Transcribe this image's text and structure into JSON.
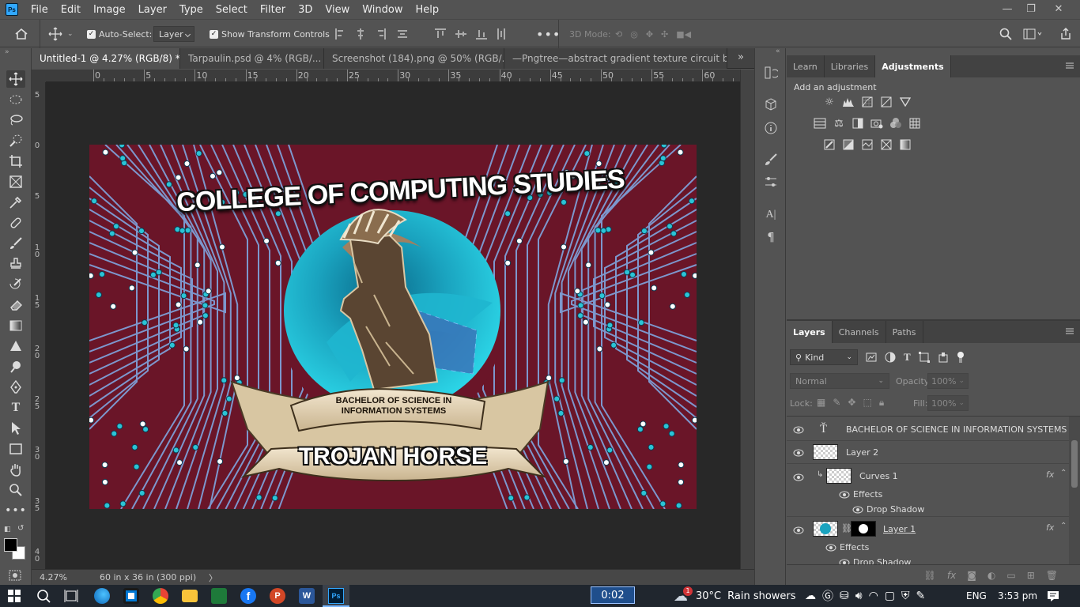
{
  "app": {
    "logo": "Ps"
  },
  "menu": [
    "File",
    "Edit",
    "Image",
    "Layer",
    "Type",
    "Select",
    "Filter",
    "3D",
    "View",
    "Window",
    "Help"
  ],
  "options": {
    "auto_select_label": "Auto-Select:",
    "auto_select_value": "Layer",
    "show_transform_label": "Show Transform Controls",
    "mode_3d_label": "3D Mode:"
  },
  "tabs": [
    {
      "label": "Untitled-1 @ 4.27% (RGB/8) *",
      "close": "×"
    },
    {
      "label": "Tarpaulin.psd @ 4% (RGB/...",
      "close": "×"
    },
    {
      "label": "Screenshot (184).png @ 50% (RGB/...",
      "close": "×"
    },
    {
      "label": "—Pngtree—abstract gradient texture circuit board",
      "close": ""
    }
  ],
  "ruler": {
    "h_labels": [
      "0",
      "5",
      "10",
      "15",
      "20",
      "25",
      "30",
      "35",
      "40",
      "45",
      "50",
      "55",
      "60"
    ],
    "v_labels": [
      "5",
      "0",
      "5",
      "1\n0",
      "1\n5",
      "2\n0",
      "2\n5",
      "3\n0",
      "3\n5",
      "4\n0"
    ]
  },
  "artwork": {
    "title": "COLLEGE OF COMPUTING STUDIES",
    "banner_line1": "BACHELOR OF SCIENCE IN",
    "banner_line2": "INFORMATION SYSTEMS",
    "ribbon": "TROJAN HORSE"
  },
  "status": {
    "zoom": "4.27%",
    "doc_size": "60 in x 36 in (300 ppi)",
    "arrow": "〉"
  },
  "adjustments_panel": {
    "tabs": [
      "Learn",
      "Libraries",
      "Adjustments"
    ],
    "active_tab": "Adjustments",
    "heading": "Add an adjustment"
  },
  "layers_panel": {
    "tabs": [
      "Layers",
      "Channels",
      "Paths"
    ],
    "active_tab": "Layers",
    "filter_kind": "Kind",
    "blend_mode": "Normal",
    "opacity_label": "Opacity:",
    "opacity_value": "100%",
    "lock_label": "Lock:",
    "fill_label": "Fill:",
    "fill_value": "100%",
    "layers": [
      {
        "name": "BACHELOR OF SCIENCE IN INFORMATION SYSTEMS",
        "kind": "warped-text"
      },
      {
        "name": "Layer 2",
        "kind": "pixel"
      },
      {
        "name": "Curves 1",
        "kind": "adjustment",
        "fx": "fx",
        "effects": "Effects",
        "effect": "Drop Shadow"
      },
      {
        "name": "Layer 1",
        "kind": "masked",
        "fx": "fx",
        "effects": "Effects",
        "effect": "Drop Shadow"
      }
    ]
  },
  "taskbar": {
    "timer": "0:02",
    "weather_badge": "1",
    "weather_temp": "30°C",
    "weather_text": "Rain showers",
    "language": "ENG",
    "time": "3:53 pm"
  },
  "colors": {
    "accent": "#31a8ff",
    "doc_bg": "#6a1528",
    "circuit": "#8fb3e8",
    "teal": "#2bc4d6"
  }
}
